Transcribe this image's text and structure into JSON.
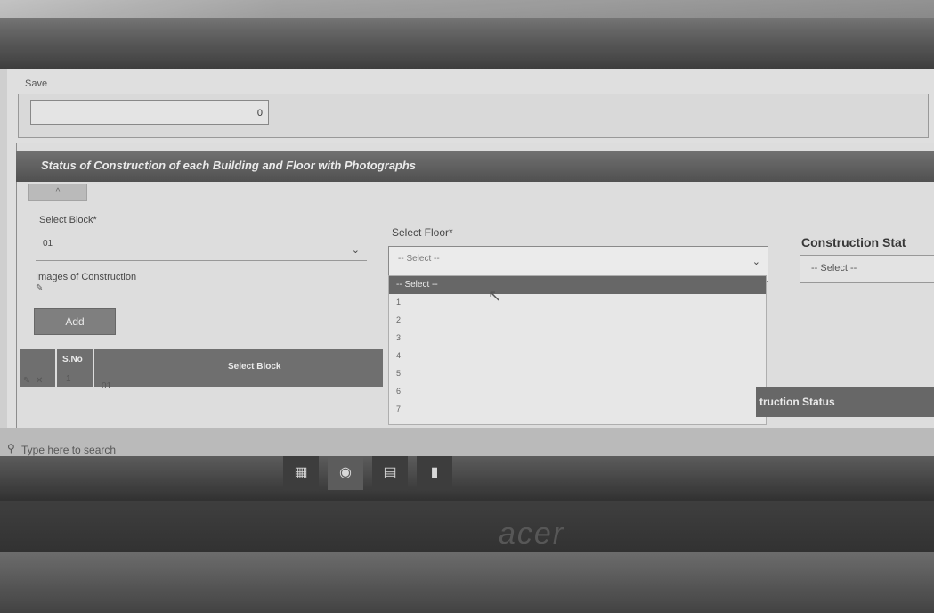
{
  "save": {
    "label": "Save",
    "value": "0"
  },
  "section": {
    "title": "Status of Construction of each Building and Floor with Photographs",
    "collapse_glyph": "^"
  },
  "block": {
    "label": "Select Block*",
    "value": "01"
  },
  "images": {
    "label": "Images of Construction",
    "icon": "paperclip-icon"
  },
  "add_button": "Add",
  "grid": {
    "headers": [
      "S.No",
      "Select Block"
    ],
    "rows": [
      {
        "sno": "1",
        "block": "01"
      }
    ],
    "row_actions": [
      "edit-icon",
      "delete-icon"
    ]
  },
  "floor": {
    "label": "Select Floor*",
    "placeholder": "-- Select --",
    "options": [
      "-- Select --",
      "1",
      "2",
      "3",
      "4",
      "5",
      "6",
      "7"
    ]
  },
  "construction_status": {
    "label": "Construction Stat",
    "placeholder": "-- Select --",
    "column_header": "truction Status"
  },
  "taskbar": {
    "search_placeholder": "Type here to search",
    "icons": [
      "task-view-icon",
      "edge-icon",
      "file-explorer-icon",
      "store-icon"
    ]
  },
  "monitor": {
    "brand": "acer"
  }
}
